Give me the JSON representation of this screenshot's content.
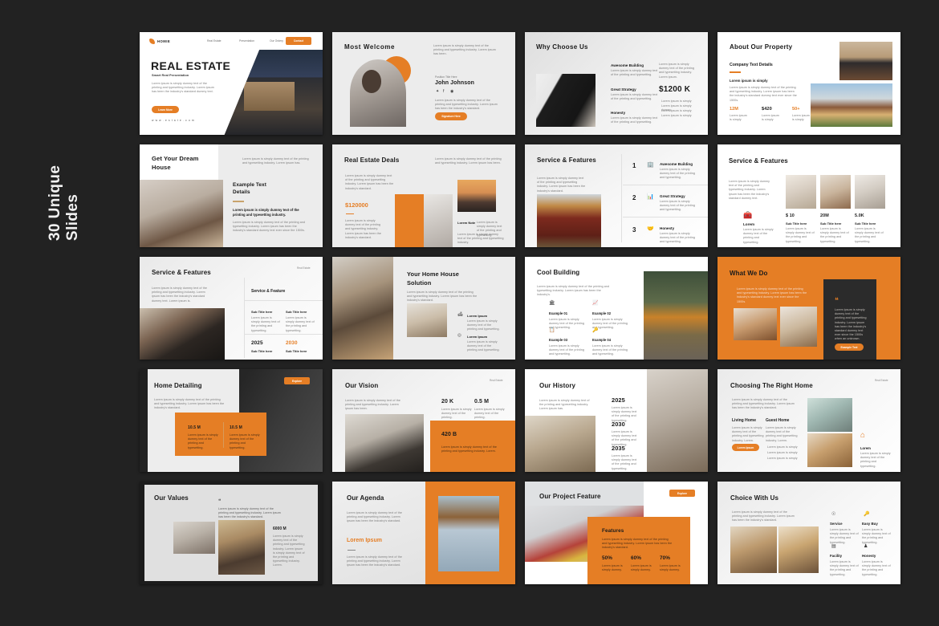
{
  "page": {
    "background_color": "#222222",
    "side_label_line1": "30 Unique",
    "side_label_line2": "Slides",
    "accent_color": "#E57E25",
    "dark_color": "#2b2b2b"
  },
  "slides": [
    {
      "id": "cover",
      "nav": {
        "brand": "HOMIE",
        "items": [
          "Real Estate",
          "Presentation",
          "Our Ordery"
        ],
        "cta": "Contact"
      },
      "title": "REAL ESTATE",
      "subtitle": "Smart Real Presentation",
      "body": "Lorem ipsum is simply dummy text of the printing and typesetting industry. Lorem ipsum has been the industry's standard dummy text.",
      "button": "Learn More",
      "url": "w w w . e s t a t e . c o m"
    },
    {
      "id": "most-welcome",
      "title": "Most Welcome",
      "top_note": "Lorem ipsum is simply dummy text of the printing and typesetting industry. Lorem ipsum has been.",
      "eyebrow": "Position Title Here",
      "name": "John Johnson",
      "socials": [
        "twitter-icon",
        "facebook-icon",
        "instagram-icon"
      ],
      "body": "Lorem ipsum is simply dummy text of the printing and typesetting industry. Lorem ipsum has been the industry's standard.",
      "button": "Signature Here"
    },
    {
      "id": "why-choose-us",
      "title": "Why Choose Us",
      "features": [
        {
          "label": "Awesome Building",
          "text": "Lorem ipsum is simply dummy text of the printing and typesetting."
        },
        {
          "label": "Great Strategy",
          "text": "Lorem ipsum is simply dummy text of the printing and typesetting."
        },
        {
          "label": "Honesty",
          "text": "Lorem ipsum is simply dummy text of the printing and typesetting."
        }
      ],
      "side_note": "Lorem ipsum is simply dummy text of the printing and typesetting industry. Lorem ipsum.",
      "stat_value": "$1200 K",
      "bullets": [
        "Lorem ipsum is simply",
        "Lorem ipsum is simply dummy",
        "Lorem ipsum is simply",
        "Lorem ipsum is simply"
      ]
    },
    {
      "id": "about-our-property",
      "title": "About Our Property",
      "subtitle": "Company Text Details",
      "lead": "Lorem ipsum is simply",
      "body": "Lorem ipsum is simply dummy text of the printing and typesetting industry. Lorem ipsum has been the industry's standard dummy text ever since the 1500s.",
      "stats": [
        {
          "value": "12M",
          "caption": "Lorem ipsum is simply"
        },
        {
          "value": "$420",
          "caption": "Lorem ipsum is simply"
        },
        {
          "value": "50+",
          "caption": "Lorem ipsum is simply"
        }
      ]
    },
    {
      "id": "get-your-dream-house",
      "title_line1": "Get Your Dream",
      "title_line2": "House",
      "top_note": "Lorem ipsum is simply dummy text of the printing and typesetting industry. Lorem ipsum has.",
      "panel_title_line1": "Example Text",
      "panel_title_line2": "Details",
      "panel_lead": "Lorem ipsum is simply dummy text of the printing and typesetting industry.",
      "panel_body": "Lorem ipsum is simply dummy text of the printing and typesetting industry. Lorem ipsum has been the industry's standard dummy text ever since the 1500s."
    },
    {
      "id": "real-estate-deals",
      "title": "Real Estate Deals",
      "top_note": "Lorem ipsum is simply dummy text of the printing and typesetting industry. Lorem ipsum has been.",
      "body": "Lorem ipsum is simply dummy text of the printing and typesetting industry. Lorem ipsum has been the industry's standard.",
      "price": "$120000",
      "price_body": "Lorem ipsum is simply dummy text of the printing and typesetting industry. Lorem ipsum has been the industry's standard.",
      "note_label": "Lorem Note",
      "note_text": "Lorem ipsum is simply dummy text of the printing and typesetting.",
      "note_body": "Lorem ipsum is simply dummy text of the printing and typesetting industry."
    },
    {
      "id": "service-features-numbered",
      "title": "Service & Features",
      "body": "Lorem ipsum is simply dummy text of the printing and typesetting industry. Lorem ipsum has been the industry's standard.",
      "items": [
        {
          "number": "1",
          "icon": "building-icon",
          "label": "Awesome Building",
          "text": "Lorem ipsum is simply dummy text of the printing and typesetting."
        },
        {
          "number": "2",
          "icon": "chart-icon",
          "label": "Great Strategy",
          "text": "Lorem ipsum is simply dummy text of the printing and typesetting."
        },
        {
          "number": "3",
          "icon": "handshake-icon",
          "label": "Honesty",
          "text": "Lorem ipsum is simply dummy text of the printing and typesetting."
        }
      ]
    },
    {
      "id": "service-features-cards",
      "title": "Service & Features",
      "body": "Lorem ipsum is simply dummy text of the printing and typesetting industry. Lorem ipsum has been the industry's standard dummy text.",
      "icon_block": {
        "icon": "briefcase-icon",
        "label": "Lorem",
        "text": "Lorem ipsum is simply dummy text of the printing and typesetting."
      },
      "cards": [
        {
          "value": "$ 10",
          "subtitle": "Sub Title here",
          "text": "Lorem ipsum is simply dummy text of the printing and typesetting."
        },
        {
          "value": "20M",
          "subtitle": "Sub Title here",
          "text": "Lorem ipsum is simply dummy text of the printing and typesetting."
        },
        {
          "value": "5.0K",
          "subtitle": "Sub Title here",
          "text": "Lorem ipsum is simply dummy text of the printing and typesetting."
        }
      ]
    },
    {
      "id": "service-features-table",
      "title": "Service & Features",
      "tag": "Real Estate",
      "body": "Lorem ipsum is simply dummy text of the printing and typesetting industry. Lorem ipsum has been the industry's standard dummy text. Lorem ipsum is.",
      "panel_title": "Service & Feature",
      "cells": [
        {
          "title": "Sub Title here",
          "text": "Lorem ipsum is simply dummy text of the printing and typesetting."
        },
        {
          "title": "Sub Title here",
          "text": "Lorem ipsum is simply dummy text of the printing and typesetting."
        }
      ],
      "years": [
        {
          "value": "2025",
          "subtitle": "Sub Title here",
          "highlight": false
        },
        {
          "value": "2030",
          "subtitle": "Sub Title here",
          "highlight": true
        }
      ]
    },
    {
      "id": "your-home-house-solution",
      "title_line1": "Your Home House",
      "title_line2": "Solution",
      "body": "Lorem ipsum is simply dummy text of the printing and typesetting industry. Lorem ipsum has been the industry's standard.",
      "items": [
        {
          "icon": "sofa-icon",
          "label": "Lorem Ipsum",
          "text": "Lorem ipsum is simply dummy text of the printing and typesetting."
        },
        {
          "icon": "location-icon",
          "label": "Lorem Ipsum",
          "text": "Lorem ipsum is simply dummy text of the printing and typesetting."
        }
      ]
    },
    {
      "id": "cool-building",
      "title": "Cool Building",
      "body": "Lorem ipsum is simply dummy text of the printing and typesetting industry. Lorem ipsum has been the industry's.",
      "items": [
        {
          "icon": "building-icon",
          "label": "Example 01",
          "text": "Lorem ipsum is simply dummy text of the printing and typesetting."
        },
        {
          "icon": "chart-icon",
          "label": "Example 02",
          "text": "Lorem ipsum is simply dummy text of the printing and typesetting."
        },
        {
          "icon": "clipboard-icon",
          "label": "Example 03",
          "text": "Lorem ipsum is simply dummy text of the printing and typesetting."
        },
        {
          "icon": "key-icon",
          "label": "Example 04",
          "text": "Lorem ipsum is simply dummy text of the printing and typesetting."
        }
      ]
    },
    {
      "id": "what-we-do",
      "title": "What We Do",
      "body": "Lorem ipsum is simply dummy text of the printing and typesetting industry. Lorem ipsum has been the industry's standard dummy text ever since the 1500s.",
      "quote_icon": "quote-icon",
      "quote": "Lorem ipsum is simply dummy text of the printing and typesetting industry. Lorem ipsum has been the industry's standard dummy text ever since the 1500s when an unknown.",
      "button": "Example Text"
    },
    {
      "id": "home-detailing",
      "title": "Home Detailing",
      "body": "Lorem ipsum is simply dummy text of the printing and typesetting industry. Lorem ipsum has been the industry's standard.",
      "button": "Explore",
      "stats": [
        {
          "value": "10.5 M",
          "text": "Lorem ipsum is simply dummy text of the printing and typesetting."
        },
        {
          "value": "10.5 M",
          "text": "Lorem ipsum is simply dummy text of the printing and typesetting."
        }
      ]
    },
    {
      "id": "our-vision",
      "title": "Our Vision",
      "tag": "Real Estate",
      "body": "Lorem ipsum is simply dummy text of the printing and typesetting industry. Lorem ipsum has been.",
      "stats": [
        {
          "value": "20 K",
          "text": "Lorem ipsum is simply dummy text of the printing."
        },
        {
          "value": "0.5 M",
          "text": "Lorem ipsum is simply dummy text of the printing."
        }
      ],
      "highlight": {
        "value": "420 B",
        "text": "Lorem ipsum is simply dummy text of the printing and typesetting industry. Lorem."
      }
    },
    {
      "id": "our-history",
      "title": "Our History",
      "body": "Lorem ipsum is simply dummy text of the printing and typesetting industry. Lorem ipsum has.",
      "timeline": [
        {
          "year": "2025",
          "text": "Lorem ipsum is simply dummy text of the printing and typesetting."
        },
        {
          "year": "2030",
          "text": "Lorem ipsum is simply dummy text of the printing and typesetting."
        },
        {
          "year": "2035",
          "text": "Lorem ipsum is simply dummy text of the printing and typesetting."
        }
      ]
    },
    {
      "id": "choosing-the-right-home",
      "title": "Choosing The Right Home",
      "tag": "Real Estate",
      "body": "Lorem ipsum is simply dummy text of the printing and typesetting industry. Lorem ipsum has been the industry's standard.",
      "columns": [
        {
          "heading": "Living Home",
          "text": "Lorem ipsum is simply dummy text of the printing and typesetting industry. Lorem."
        },
        {
          "heading": "Guest Home",
          "text": "Lorem ipsum is simply dummy text of the printing and typesetting industry. Lorem."
        }
      ],
      "button": "Lorem Ipsum",
      "bullets": [
        "Lorem ipsum is simply",
        "Lorem ipsum is simply",
        "Lorem ipsum is simply"
      ],
      "side": {
        "icon": "home-icon",
        "label": "Lorem",
        "text": "Lorem ipsum is simply dummy text of the printing and typesetting."
      }
    },
    {
      "id": "our-values",
      "title": "Our Values",
      "quote_icon": "quote-icon",
      "quote": "Lorem ipsum is simply dummy text of the printing and typesetting industry. Lorem ipsum has been the industry's standard.",
      "stat_value": "6000 M",
      "stat_text": "Lorem ipsum is simply dummy text of the printing and typesetting industry. Lorem ipsum is simply dummy text of the printing and typesetting industry. Lorem."
    },
    {
      "id": "our-agenda",
      "title": "Our Agenda",
      "body": "Lorem ipsum is simply dummy text of the printing and typesetting industry. Lorem ipsum has been the industry's standard.",
      "subtitle": "Lorem Ipsum",
      "sub_body": "Lorem ipsum is simply dummy text of the printing and typesetting industry. Lorem ipsum has been the industry's standard."
    },
    {
      "id": "our-project-feature",
      "title": "Our Project Feature",
      "button": "Explore",
      "panel_title": "Features",
      "panel_body": "Lorem ipsum is simply dummy text of the printing and typesetting industry. Lorem ipsum has been the industry's standard.",
      "stats": [
        {
          "value": "50%",
          "text": "Lorem ipsum is simply dummy."
        },
        {
          "value": "60%",
          "text": "Lorem ipsum is simply dummy."
        },
        {
          "value": "70%",
          "text": "Lorem ipsum is simply dummy."
        }
      ]
    },
    {
      "id": "choice-with-us",
      "title": "Choice With Us",
      "body": "Lorem ipsum is simply dummy text of the printing and typesetting industry. Lorem ipsum has been the industry's standard.",
      "items": [
        {
          "icon": "service-icon",
          "label": "Service",
          "text": "Lorem ipsum is simply dummy text of the printing and typesetting."
        },
        {
          "icon": "key-icon",
          "label": "Easy Buy",
          "text": "Lorem ipsum is simply dummy text of the printing and typesetting."
        },
        {
          "icon": "facility-icon",
          "label": "Facility",
          "text": "Lorem ipsum is simply dummy text of the printing and typesetting."
        },
        {
          "icon": "honesty-icon",
          "label": "Honesty",
          "text": "Lorem ipsum is simply dummy text of the printing and typesetting."
        }
      ]
    }
  ]
}
